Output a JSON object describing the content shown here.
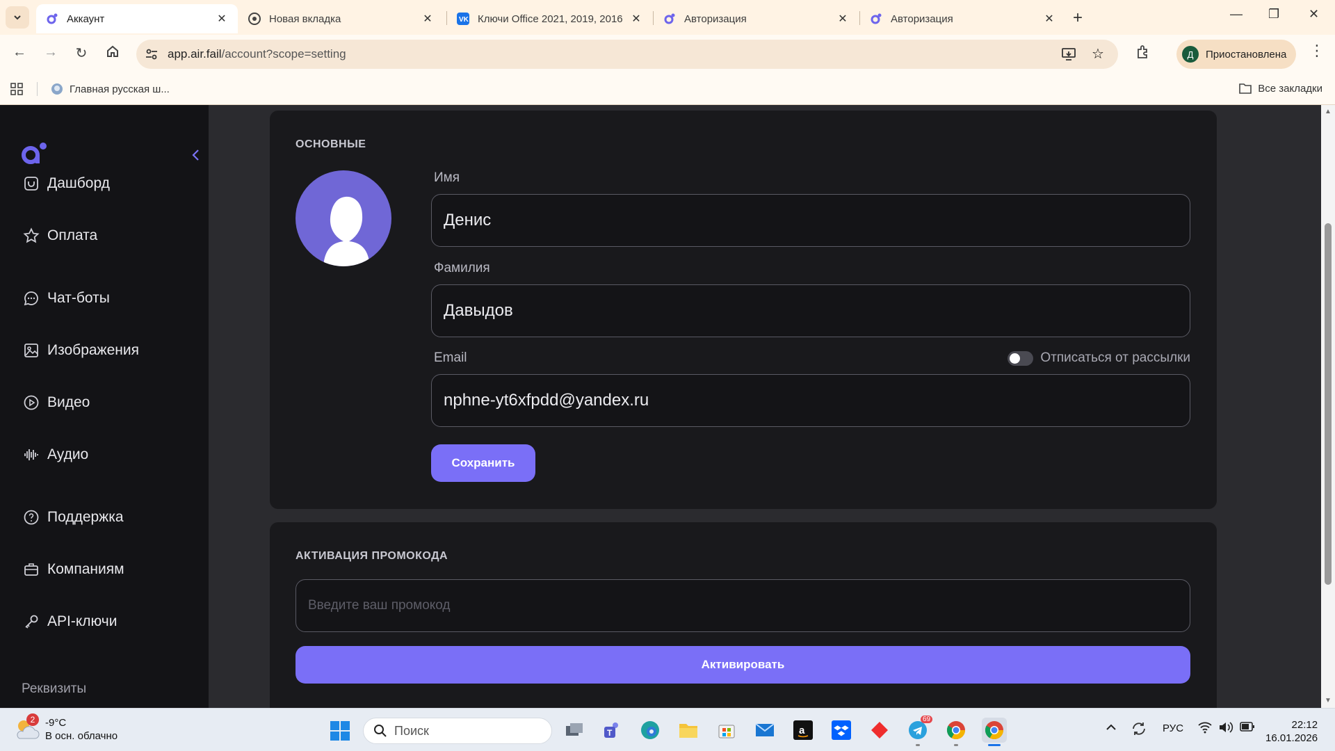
{
  "browser": {
    "tabs": [
      {
        "title": "Аккаунт",
        "active": true
      },
      {
        "title": "Новая вкладка",
        "active": false
      },
      {
        "title": "Ключи Office 2021, 2019, 2016",
        "active": false
      },
      {
        "title": "Авторизация",
        "active": false
      },
      {
        "title": "Авторизация",
        "active": false
      }
    ],
    "url_host": "app.air.fail",
    "url_path": "/account?scope=setting",
    "profile_initial": "Д",
    "profile_label": "Приостановлена",
    "bookmark": "Главная русская ш...",
    "all_bookmarks": "Все закладки"
  },
  "sidebar": {
    "items": [
      {
        "label": "Дашборд",
        "icon": "dashboard-icon"
      },
      {
        "label": "Оплата",
        "icon": "star-icon"
      },
      {
        "label": "Чат-боты",
        "icon": "chat-icon"
      },
      {
        "label": "Изображения",
        "icon": "image-icon"
      },
      {
        "label": "Видео",
        "icon": "play-icon"
      },
      {
        "label": "Аудио",
        "icon": "audio-wave-icon"
      },
      {
        "label": "Поддержка",
        "icon": "help-icon"
      },
      {
        "label": "Компаниям",
        "icon": "briefcase-icon"
      },
      {
        "label": "API-ключи",
        "icon": "key-icon"
      }
    ],
    "requisites": "Реквизиты"
  },
  "profile": {
    "section_title": "ОСНОВНЫЕ",
    "first_name_label": "Имя",
    "first_name": "Денис",
    "last_name_label": "Фамилия",
    "last_name": "Давыдов",
    "email_label": "Email",
    "email": "nphne-yt6xfpdd@yandex.ru",
    "unsubscribe_label": "Отписаться от рассылки",
    "unsubscribe_on": false,
    "save_label": "Сохранить"
  },
  "promo": {
    "section_title": "АКТИВАЦИЯ ПРОМОКОДА",
    "placeholder": "Введите ваш промокод",
    "activate_label": "Активировать"
  },
  "colors": {
    "accent": "#7a6ff7",
    "sidebar_bg": "#131316",
    "card_bg": "#19191c",
    "page_bg": "#2b2b2f"
  },
  "taskbar": {
    "weather_temp": "-9°C",
    "weather_desc": "В осн. облачно",
    "weather_badge": "2",
    "search_placeholder": "Поиск",
    "telegram_badge": "69",
    "language": "РУС",
    "time": "22:12",
    "date": "16.01.2026"
  }
}
